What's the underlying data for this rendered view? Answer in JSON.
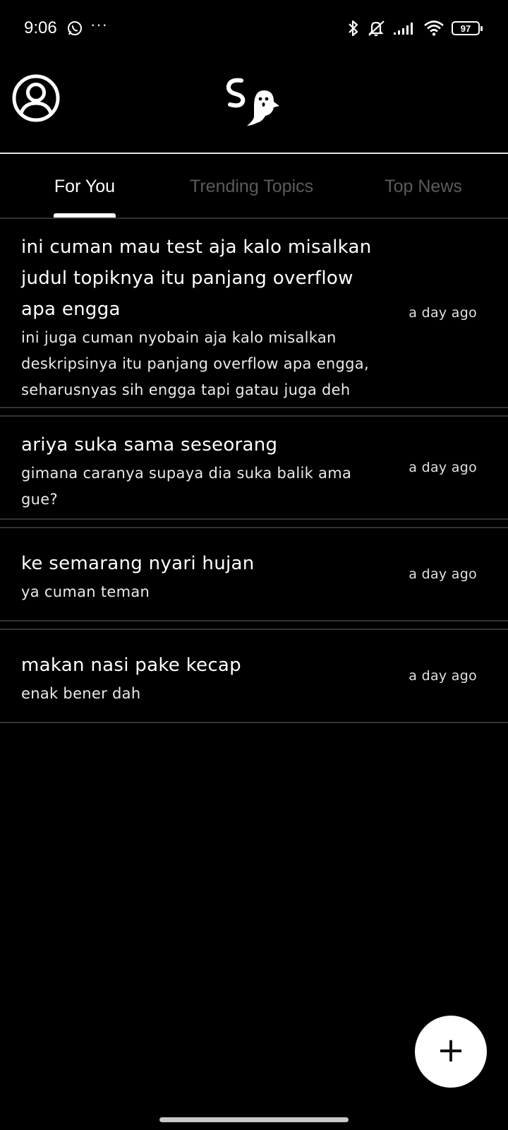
{
  "status_bar": {
    "time": "9:06",
    "more_indicator": "···",
    "battery_level": "97",
    "icons": [
      "whatsapp-icon",
      "bluetooth-icon",
      "silent-icon",
      "signal-icon",
      "wifi-icon",
      "battery-icon"
    ]
  },
  "header": {
    "avatar_icon": "user-circle-icon",
    "logo_icon": "ghost-logo-icon"
  },
  "tabs": [
    {
      "label": "For You",
      "active": true
    },
    {
      "label": "Trending Topics",
      "active": false
    },
    {
      "label": "Top News",
      "active": false
    }
  ],
  "posts": [
    {
      "title": "ini cuman mau test aja kalo misalkan judul topiknya itu panjang overflow apa engga",
      "description": "ini juga cuman nyobain aja kalo misalkan deskripsinya itu panjang overflow apa engga, seharusnyas sih engga tapi gatau juga deh",
      "time": "a day ago"
    },
    {
      "title": "ariya suka sama seseorang",
      "description": "gimana caranya supaya dia suka balik ama gue?",
      "time": "a day ago"
    },
    {
      "title": "ke semarang nyari hujan",
      "description": "ya cuman teman",
      "time": "a day ago"
    },
    {
      "title": "makan nasi pake kecap",
      "description": "enak bener dah",
      "time": "a day ago"
    }
  ],
  "fab": {
    "label": "+",
    "icon": "plus-icon"
  },
  "colors": {
    "background": "#000000",
    "text": "#ffffff",
    "inactive_tab": "#5b5b5b",
    "divider": "#333333",
    "fab": "#ffffff"
  }
}
